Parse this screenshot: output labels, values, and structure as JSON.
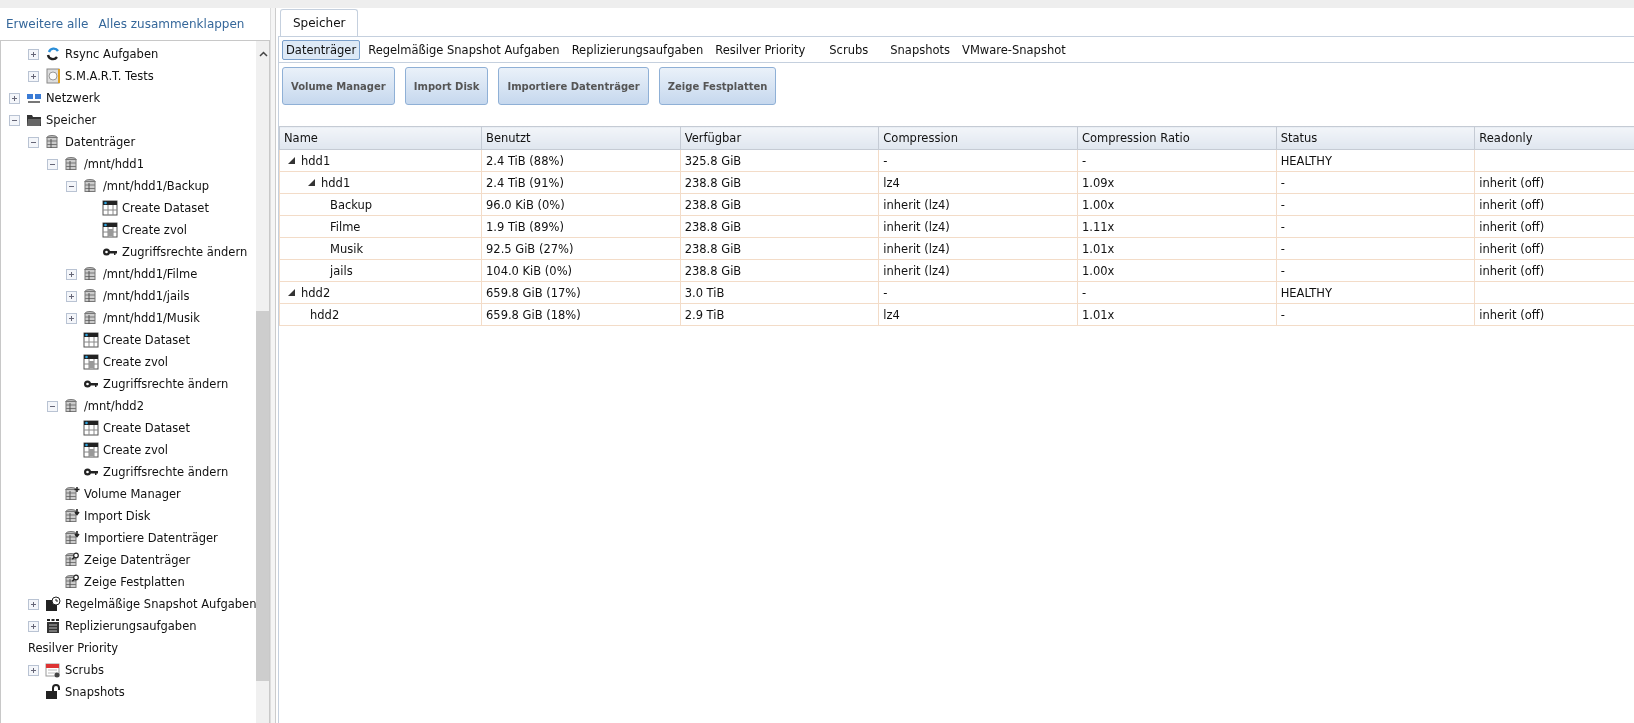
{
  "sidebar": {
    "links": [
      "Erweitere alle",
      "Alles zusammenklappen"
    ],
    "tree": [
      {
        "children": [
          {
            "label": "Rsync Aufgaben",
            "kind": "sync",
            "expanded": false
          },
          {
            "label": "S.M.A.R.T. Tests",
            "kind": "smart",
            "expanded": false
          }
        ]
      },
      {
        "label": "Netzwerk",
        "kind": "network",
        "expanded": false
      },
      {
        "label": "Speicher",
        "kind": "folder",
        "expanded": true,
        "children": [
          {
            "label": "Datenträger",
            "kind": "disk",
            "expanded": true,
            "children": [
              {
                "label": "/mnt/hdd1",
                "kind": "disk",
                "expanded": true,
                "children": [
                  {
                    "label": "/mnt/hdd1/Backup",
                    "kind": "disk",
                    "expanded": true,
                    "children": [
                      {
                        "label": "Create Dataset",
                        "kind": "table"
                      },
                      {
                        "label": "Create zvol",
                        "kind": "table-disk"
                      },
                      {
                        "label": "Zugriffsrechte ändern",
                        "kind": "key"
                      }
                    ]
                  },
                  {
                    "label": "/mnt/hdd1/Filme",
                    "kind": "disk",
                    "expanded": false
                  },
                  {
                    "label": "/mnt/hdd1/jails",
                    "kind": "disk",
                    "expanded": false
                  },
                  {
                    "label": "/mnt/hdd1/Musik",
                    "kind": "disk",
                    "expanded": false
                  },
                  {
                    "label": "Create Dataset",
                    "kind": "table"
                  },
                  {
                    "label": "Create zvol",
                    "kind": "table-disk"
                  },
                  {
                    "label": "Zugriffsrechte ändern",
                    "kind": "key"
                  }
                ]
              },
              {
                "label": "/mnt/hdd2",
                "kind": "disk",
                "expanded": true,
                "children": [
                  {
                    "label": "Create Dataset",
                    "kind": "table"
                  },
                  {
                    "label": "Create zvol",
                    "kind": "table-disk"
                  },
                  {
                    "label": "Zugriffsrechte ändern",
                    "kind": "key"
                  }
                ]
              },
              {
                "label": "Volume Manager",
                "kind": "disk-plus"
              },
              {
                "label": "Import Disk",
                "kind": "disk-import"
              },
              {
                "label": "Importiere Datenträger",
                "kind": "disk-import"
              },
              {
                "label": "Zeige Datenträger",
                "kind": "disk-search"
              },
              {
                "label": "Zeige Festplatten",
                "kind": "disk-search"
              }
            ]
          },
          {
            "label": "Regelmäßige Snapshot Aufgaben",
            "kind": "clock-task",
            "expanded": false
          },
          {
            "label": "Replizierungsaufgaben",
            "kind": "replication",
            "expanded": false
          },
          {
            "label": "Resilver Priority"
          },
          {
            "label": "Scrubs",
            "kind": "calendar",
            "expanded": false
          },
          {
            "label": "Snapshots",
            "kind": "lock"
          }
        ]
      }
    ]
  },
  "main_tab": {
    "label": "Speicher",
    "selected": true
  },
  "sub_tabs": [
    {
      "label": "Datenträger",
      "selected": true
    },
    {
      "label": "Regelmäßige Snapshot Aufgaben",
      "selected": false
    },
    {
      "label": "Replizierungsaufgaben",
      "selected": false
    },
    {
      "label": "Resilver Priority",
      "selected": false
    },
    {
      "label": "Scrubs",
      "selected": false
    },
    {
      "label": "Snapshots",
      "selected": false
    },
    {
      "label": "VMware-Snapshot",
      "selected": false
    }
  ],
  "buttons": [
    "Volume Manager",
    "Import Disk",
    "Importiere Datenträger",
    "Zeige Festplatten"
  ],
  "table": {
    "columns": [
      "Name",
      "Benutzt",
      "Verfügbar",
      "Compression",
      "Compression Ratio",
      "Status",
      "Readonly"
    ],
    "rows": [
      {
        "cells": [
          "hdd1",
          "2.4 TiB (88%)",
          "325.8 GiB",
          "-",
          "-",
          "HEALTHY",
          ""
        ],
        "expanded": true,
        "children": [
          {
            "cells": [
              "hdd1",
              "2.4 TiB (91%)",
              "238.8 GiB",
              "lz4",
              "1.09x",
              "-",
              "inherit (off)"
            ],
            "expanded": true,
            "children": [
              {
                "cells": [
                  "Backup",
                  "96.0 KiB (0%)",
                  "238.8 GiB",
                  "inherit (lz4)",
                  "1.00x",
                  "-",
                  "inherit (off)"
                ]
              },
              {
                "cells": [
                  "Filme",
                  "1.9 TiB (89%)",
                  "238.8 GiB",
                  "inherit (lz4)",
                  "1.11x",
                  "-",
                  "inherit (off)"
                ]
              },
              {
                "cells": [
                  "Musik",
                  "92.5 GiB (27%)",
                  "238.8 GiB",
                  "inherit (lz4)",
                  "1.01x",
                  "-",
                  "inherit (off)"
                ]
              },
              {
                "cells": [
                  "jails",
                  "104.0 KiB (0%)",
                  "238.8 GiB",
                  "inherit (lz4)",
                  "1.00x",
                  "-",
                  "inherit (off)"
                ]
              }
            ]
          }
        ]
      },
      {
        "cells": [
          "hdd2",
          "659.8 GiB (17%)",
          "3.0 TiB",
          "-",
          "-",
          "HEALTHY",
          ""
        ],
        "expanded": true,
        "children": [
          {
            "cells": [
              "hdd2",
              "659.8 GiB (18%)",
              "2.9 TiB",
              "lz4",
              "1.01x",
              "-",
              "inherit (off)"
            ]
          }
        ]
      }
    ]
  }
}
